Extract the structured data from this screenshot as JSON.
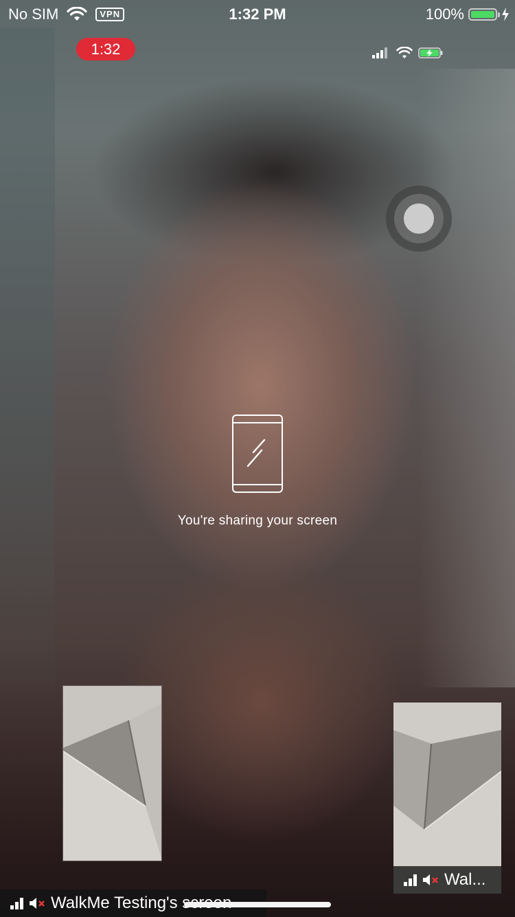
{
  "status_bar": {
    "carrier": "No SIM",
    "vpn": "VPN",
    "time": "1:32 PM",
    "battery_percent": "100%",
    "battery_level": 1.0,
    "battery_color": "#4cd964"
  },
  "call": {
    "timer": "1:32",
    "timer_color": "#e02a36"
  },
  "sharing": {
    "message": "You're sharing your screen",
    "icon": "phone-share-icon"
  },
  "thumbnails": {
    "right": {
      "label": "Wal..."
    }
  },
  "bottom_bar": {
    "label": "WalkMe Testing's screen"
  }
}
